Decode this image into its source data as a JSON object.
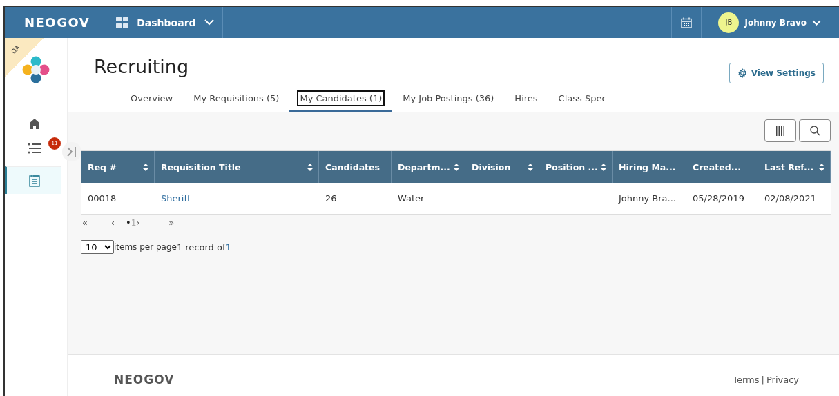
{
  "header": {
    "brand": "NEOGOV",
    "app_menu": "Dashboard",
    "user": {
      "initials": "JB",
      "name": "Johnny Bravo"
    }
  },
  "sidebar": {
    "environment": "QA",
    "items": [
      {
        "kind": "home",
        "selected": false
      },
      {
        "kind": "list",
        "selected": false,
        "badge": "11"
      },
      {
        "kind": "notepad",
        "selected": true
      }
    ]
  },
  "page": {
    "title": "Recruiting",
    "view_settings": "View Settings"
  },
  "tabs": [
    {
      "label": "Overview",
      "selected": false
    },
    {
      "label": "My Requisitions (5)",
      "selected": false
    },
    {
      "label": "My Candidates (1)",
      "selected": true
    },
    {
      "label": "My Job Postings (36)",
      "selected": false
    },
    {
      "label": "Hires",
      "selected": false
    },
    {
      "label": "Class Spec",
      "selected": false
    }
  ],
  "table": {
    "columns": [
      {
        "label": "Req #",
        "sortable": true
      },
      {
        "label": "Requisition Title",
        "sortable": true
      },
      {
        "label": "Candidates",
        "sortable": false
      },
      {
        "label": "Departm...",
        "sortable": true
      },
      {
        "label": "Division",
        "sortable": true
      },
      {
        "label": "Position ...",
        "sortable": true
      },
      {
        "label": "Hiring Ma...",
        "sortable": false
      },
      {
        "label": "Created...",
        "sortable": false
      },
      {
        "label": "Last Ref...",
        "sortable": true
      }
    ],
    "rows": [
      {
        "cells": [
          {
            "kind": "text",
            "text": "00018"
          },
          {
            "kind": "link",
            "text": "Sheriff"
          },
          {
            "kind": "text",
            "text": "26"
          },
          {
            "kind": "text",
            "text": "Water"
          },
          {
            "kind": "empty"
          },
          {
            "kind": "empty"
          },
          {
            "kind": "text",
            "text": "Johnny Bra..."
          },
          {
            "kind": "text",
            "text": "05/28/2019"
          },
          {
            "kind": "text",
            "text": "02/08/2021"
          }
        ]
      }
    ]
  },
  "pagination": {
    "first": "«",
    "prev": "‹",
    "current_marker": "•",
    "page": "1",
    "next": "›",
    "last": "»",
    "page_size": "10",
    "page_size_label": "items per page",
    "record_text": "1 record of ",
    "record_total": "1"
  },
  "footer": {
    "brand": "NEOGOV",
    "links": [
      "Terms",
      "Privacy"
    ],
    "separator": "|"
  }
}
